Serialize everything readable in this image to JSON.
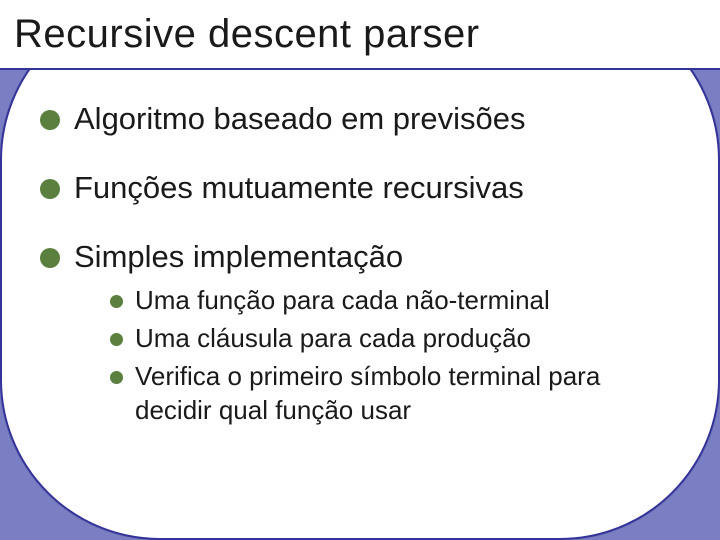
{
  "slide": {
    "title": "Recursive descent parser",
    "bullets": [
      {
        "text": "Algoritmo baseado em previsões"
      },
      {
        "text": "Funções mutuamente recursivas"
      },
      {
        "text": "Simples implementação",
        "children": [
          "Uma função para cada não-terminal",
          "Uma cláusula para cada produção",
          "Verifica o primeiro símbolo terminal para decidir qual função usar"
        ]
      }
    ]
  }
}
